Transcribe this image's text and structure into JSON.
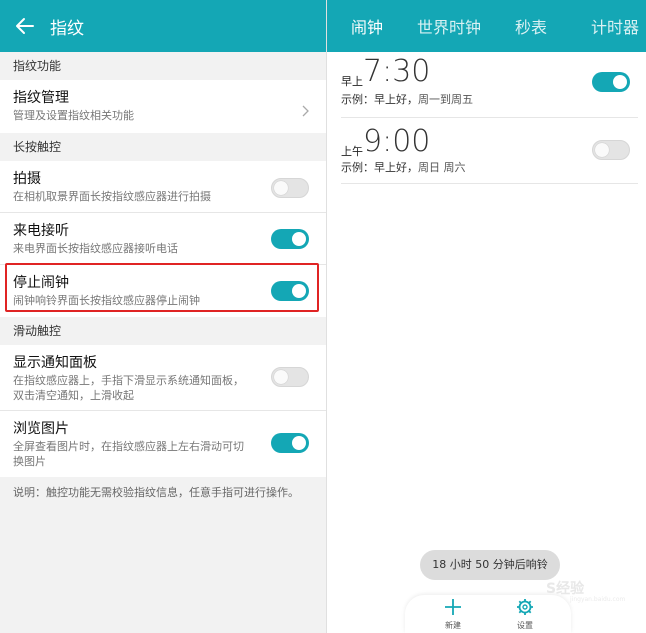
{
  "left": {
    "header": {
      "title": "指纹"
    },
    "sections": {
      "fingerprint_function": "指纹功能",
      "long_press": "长按触控",
      "swipe": "滑动触控"
    },
    "manage": {
      "title": "指纹管理",
      "subtitle": "管理及设置指纹相关功能"
    },
    "photo": {
      "title": "拍摄",
      "subtitle": "在相机取景界面长按指纹感应器进行拍摄",
      "enabled": false
    },
    "answer_call": {
      "title": "来电接听",
      "subtitle": "来电界面长按指纹感应器接听电话",
      "enabled": true
    },
    "stop_alarm": {
      "title": "停止闹钟",
      "subtitle": "闹钟响铃界面长按指纹感应器停止闹钟",
      "enabled": true
    },
    "notification_panel": {
      "title": "显示通知面板",
      "subtitle": "在指纹感应器上，手指下滑显示系统通知面板，双击清空通知，上滑收起",
      "enabled": false
    },
    "browse_photos": {
      "title": "浏览图片",
      "subtitle": "全屏查看图片时，在指纹感应器上左右滑动可切换图片",
      "enabled": true
    },
    "note": "说明：触控功能无需校验指纹信息，任意手指可进行操作。"
  },
  "right": {
    "tabs": [
      "闹钟",
      "世界时钟",
      "秒表",
      "计时器"
    ],
    "active_tab": "闹钟",
    "alarms": [
      {
        "period": "早上",
        "time": "7:30",
        "label": "示例：早上好，",
        "repeat": "周一到周五",
        "enabled": true
      },
      {
        "period": "上午",
        "time": "9:00",
        "label": "示例：早上好，",
        "repeat": "周日 周六",
        "enabled": false
      }
    ],
    "next_ring": "18 小时 50 分钟后响铃",
    "bottom_bar": {
      "new_label": "新建",
      "settings_label": "设置"
    },
    "watermark": "S经验",
    "watermark_sub": "jingyan.baidu.com"
  },
  "colors": {
    "accent": "#14a7b5",
    "highlight": "#e02424"
  }
}
